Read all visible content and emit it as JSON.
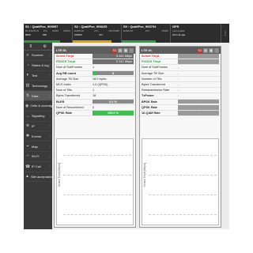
{
  "top": {
    "cells": [
      {
        "title": "S1 : QualiPoc_905997",
        "headers": [
          "DL EARFCN",
          "PCI",
          "RSRP",
          "RSRQ"
        ],
        "values": [
          "8300",
          "408",
          "",
          ""
        ],
        "bar_color": "#2e9e46",
        "bar_fill": 0.75
      },
      {
        "title": "S2 : QualiPoc_908225",
        "headers": [
          "EARFCN",
          "PCI",
          "NR RSRP",
          ""
        ],
        "values": [
          "100812",
          "127",
          "",
          ""
        ],
        "bar_color": "#e0a400",
        "bar_fill": 0.8
      },
      {
        "title": "S3 : QualiPoc_906704",
        "headers": [
          "EARFCN",
          "PCI",
          "RSRP",
          ""
        ],
        "values": [
          "",
          "",
          "",
          ""
        ],
        "bar_color": "#2e9e46",
        "bar_fill": 0.7
      }
    ],
    "gps": {
      "title": "GPS",
      "line1": "Last update",
      "line2": "3min 4s ago"
    }
  },
  "sidebar": {
    "tools": [
      "pin-icon",
      "settings-icon"
    ],
    "items": [
      {
        "label": "Scanner",
        "icon": "scanner-icon",
        "glyph": "≡"
      },
      {
        "label": "Status & log",
        "icon": "status-icon",
        "glyph": "◔"
      },
      {
        "label": "Test",
        "icon": "test-icon",
        "glyph": "⏵"
      },
      {
        "label": "Technology",
        "icon": "technology-icon",
        "glyph": "▥"
      },
      {
        "label": "Data",
        "icon": "data-icon",
        "glyph": "⇅",
        "active": true
      },
      {
        "label": "Cells & coverage",
        "icon": "cells-icon",
        "glyph": "◉"
      },
      {
        "label": "Signaling",
        "icon": "signaling-icon",
        "glyph": "↔"
      },
      {
        "label": "IP",
        "icon": "ip-icon",
        "glyph": "⊕"
      },
      {
        "label": "Events",
        "icon": "events-icon",
        "glyph": "✱"
      },
      {
        "label": "Map",
        "icon": "map-icon",
        "glyph": "⌖"
      },
      {
        "label": "Wi-Fi",
        "icon": "wifi-icon",
        "glyph": "◠"
      },
      {
        "label": "IP Call",
        "icon": "ipcall-icon",
        "glyph": "☎"
      },
      {
        "label": "Site acceptance",
        "icon": "site-icon",
        "glyph": "▲"
      }
    ]
  },
  "panel1": {
    "title": "LTE DL",
    "badge": "S1",
    "rows": [
      {
        "label": "Sched Thrpt",
        "value": "0.141 Mbps",
        "style": "red",
        "vstyle": "boxed"
      },
      {
        "label": "PDSCH Thrpt",
        "value": "0.141 Mbps",
        "style": "green",
        "vstyle": "boxed"
      },
      {
        "label": "Num of SubFrames",
        "value": "1",
        "style": "",
        "vstyle": ""
      },
      {
        "label": "Avg RB count",
        "value": "8",
        "style": "bold",
        "vstyle": "bar",
        "fill": 0.1
      },
      {
        "label": "Average TB Size",
        "value": "18.0 bytes",
        "style": "",
        "vstyle": ""
      },
      {
        "label": "MCS Index",
        "value": "1.0 (QPSK)",
        "style": "",
        "vstyle": ""
      },
      {
        "label": "Num of TBs",
        "value": "1",
        "style": "",
        "vstyle": ""
      },
      {
        "label": "Bytes Transferred",
        "value": "18",
        "style": "",
        "vstyle": ""
      },
      {
        "label": "BLER",
        "value": "0.0 %",
        "style": "bold",
        "vstyle": "bar",
        "fill": 0.0
      },
      {
        "label": "Num of Recombined",
        "value": "0",
        "style": "",
        "vstyle": ""
      },
      {
        "label": "QPSK Rate",
        "value": "100.0 %",
        "style": "bold",
        "vstyle": "bar",
        "fill": 1.0
      }
    ],
    "chart_ylabel": "Sched Thrpt [Mbps]"
  },
  "panel2": {
    "title": "LTE UL",
    "badge": "S1",
    "rows": [
      {
        "label": "Sched Thrpt",
        "value": "-",
        "style": "red",
        "vstyle": "grey"
      },
      {
        "label": "PUSCH Thrpt",
        "value": "-",
        "style": "green",
        "vstyle": "grey"
      },
      {
        "label": "Num of SubFrames",
        "value": "-",
        "style": "",
        "vstyle": ""
      },
      {
        "label": "Average TB Size",
        "value": "-",
        "style": "",
        "vstyle": ""
      },
      {
        "label": "Number of TBs",
        "value": "-",
        "style": "",
        "vstyle": ""
      },
      {
        "label": "Bytes Transferred",
        "value": "-",
        "style": "",
        "vstyle": ""
      },
      {
        "label": "Retransmission Rate",
        "value": "-",
        "style": "",
        "vstyle": ""
      },
      {
        "label": "TxPower",
        "value": "-",
        "style": "bold",
        "vstyle": ""
      },
      {
        "label": "BPSK Rate",
        "value": "-",
        "style": "bold",
        "vstyle": "grey"
      },
      {
        "label": "QPSK Rate",
        "value": "-",
        "style": "bold",
        "vstyle": "grey"
      },
      {
        "label": "16-QAM Rate",
        "value": "-",
        "style": "bold",
        "vstyle": "grey"
      }
    ],
    "chart_ylabel": "Sched Thrpt [Mbps]"
  }
}
